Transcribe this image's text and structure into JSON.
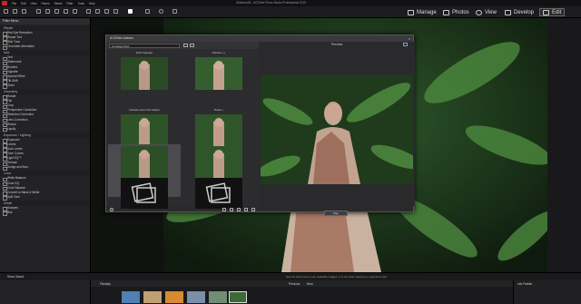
{
  "menu": [
    "File",
    "Edit",
    "View",
    "Panes",
    "Select",
    "Filter",
    "Tools",
    "Help"
  ],
  "window_title": "Shimmer05 - ACDSee Photo Studio Professional 2019",
  "modes": [
    {
      "label": "Manage",
      "icon": "manage-icon"
    },
    {
      "label": "Photos",
      "icon": "photos-icon"
    },
    {
      "label": "View",
      "icon": "view-icon"
    },
    {
      "label": "Develop",
      "icon": "develop-icon"
    },
    {
      "label": "Edit",
      "icon": "edit-icon"
    }
  ],
  "left_panel": {
    "title": "Filter Menu",
    "sections": [
      {
        "name": "Repair",
        "items": [
          "Red Eye Reduction",
          "Repair Tool",
          "Skin Tune",
          "Chromatic Aberration"
        ]
      },
      {
        "name": "Add",
        "items": [
          "Text",
          "Watermark",
          "Borders",
          "Vignette",
          "Special Effect",
          "Tilt-Shift",
          "Grain"
        ]
      },
      {
        "name": "Geometry",
        "items": [
          "Rotate",
          "Flip",
          "Crop",
          "Perspective Correction",
          "Distortion Correction",
          "Lens Correction",
          "Resize",
          "Liquify"
        ]
      },
      {
        "name": "Exposure / Lighting",
        "items": [
          "Exposure",
          "Levels",
          "Auto Levels",
          "Tone Curves",
          "Light EQ™",
          "Dehaze",
          "Dodge and Burn"
        ]
      },
      {
        "name": "Color",
        "items": [
          "White Balance",
          "Color EQ",
          "Color Balance",
          "Convert to Black & White",
          "Split Tone"
        ]
      },
      {
        "name": "Detail",
        "items": [
          "Sharpen",
          "Blur"
        ]
      }
    ]
  },
  "left_bottom": "Show Saved",
  "modal": {
    "title": "ACDSee Actions",
    "category": "Uncategorized",
    "preview_label": "Preview",
    "play_label": "Play",
    "actions": [
      "Dark Vignette",
      "Dehaze ++",
      "Dehaze and Color Adjust",
      "Detail +",
      "Dehaze",
      "Duplicate + Mask",
      "",
      ""
    ]
  },
  "status_text": "Use the Hand tool to pan available images or to set when drawing or selection tools.",
  "filmstrip": {
    "label": "Filmstrip",
    "prev": "Previous",
    "next": "Next"
  },
  "info_palette": "Info Palette",
  "colors": {
    "accent": "#c9252c",
    "panel": "#232326"
  }
}
